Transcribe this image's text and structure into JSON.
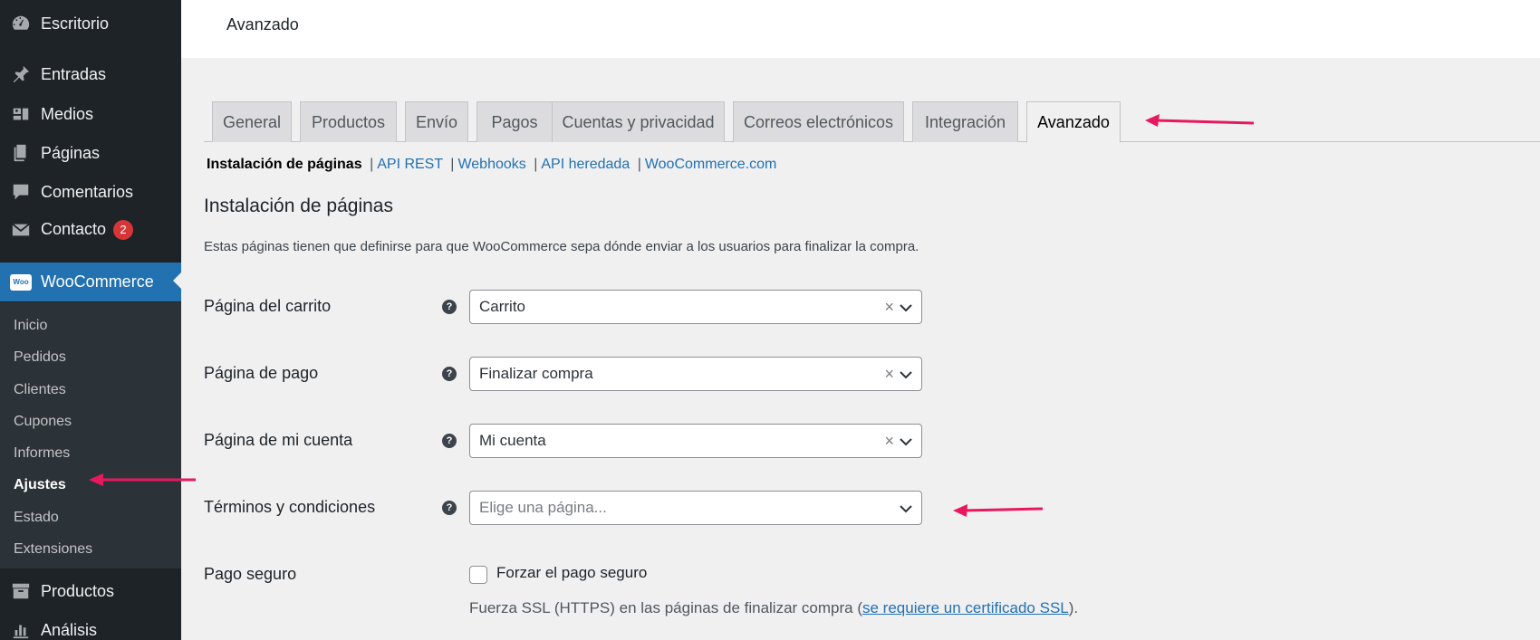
{
  "sidebar": {
    "items": [
      {
        "label": "Escritorio",
        "icon": "dashboard-icon"
      },
      {
        "label": "Entradas",
        "icon": "pin-icon"
      },
      {
        "label": "Medios",
        "icon": "media-icon"
      },
      {
        "label": "Páginas",
        "icon": "pages-icon"
      },
      {
        "label": "Comentarios",
        "icon": "comment-icon"
      },
      {
        "label": "Contacto",
        "icon": "mail-icon",
        "badge": "2"
      },
      {
        "label": "WooCommerce",
        "icon": "woocommerce-icon"
      },
      {
        "label": "Productos",
        "icon": "archive-icon"
      },
      {
        "label": "Análisis",
        "icon": "chart-icon"
      }
    ],
    "woo_logo_text": "Woo",
    "submenu": [
      "Inicio",
      "Pedidos",
      "Clientes",
      "Cupones",
      "Informes",
      "Ajustes",
      "Estado",
      "Extensiones"
    ]
  },
  "header": {
    "title": "Avanzado"
  },
  "tabs": [
    "General",
    "Productos",
    "Envío",
    "Pagos",
    "Cuentas y privacidad",
    "Correos electrónicos",
    "Integración",
    "Avanzado"
  ],
  "subnav": {
    "current": "Instalación de páginas",
    "links": [
      "API REST",
      "Webhooks",
      "API heredada",
      "WooCommerce.com"
    ],
    "separator": "|"
  },
  "section": {
    "title": "Instalación de páginas",
    "description": "Estas páginas tienen que definirse para que WooCommerce sepa dónde enviar a los usuarios para finalizar la compra."
  },
  "fields": {
    "cart": {
      "label": "Página del carrito",
      "value": "Carrito"
    },
    "checkout": {
      "label": "Página de pago",
      "value": "Finalizar compra"
    },
    "myaccount": {
      "label": "Página de mi cuenta",
      "value": "Mi cuenta"
    },
    "terms": {
      "label": "Términos y condiciones",
      "placeholder": "Elige una página..."
    },
    "secure": {
      "label": "Pago seguro",
      "checkbox_label": "Forzar el pago seguro",
      "desc_prefix": "Fuerza SSL (HTTPS) en las páginas de finalizar compra (",
      "desc_link": "se requiere un certificado SSL",
      "desc_suffix": ")."
    }
  },
  "help_glyph": "?",
  "clear_glyph": "×",
  "colors": {
    "accent": "#2271b1",
    "sidebar": "#1d2327",
    "annotation": "#e8185f",
    "badge": "#d63638"
  }
}
